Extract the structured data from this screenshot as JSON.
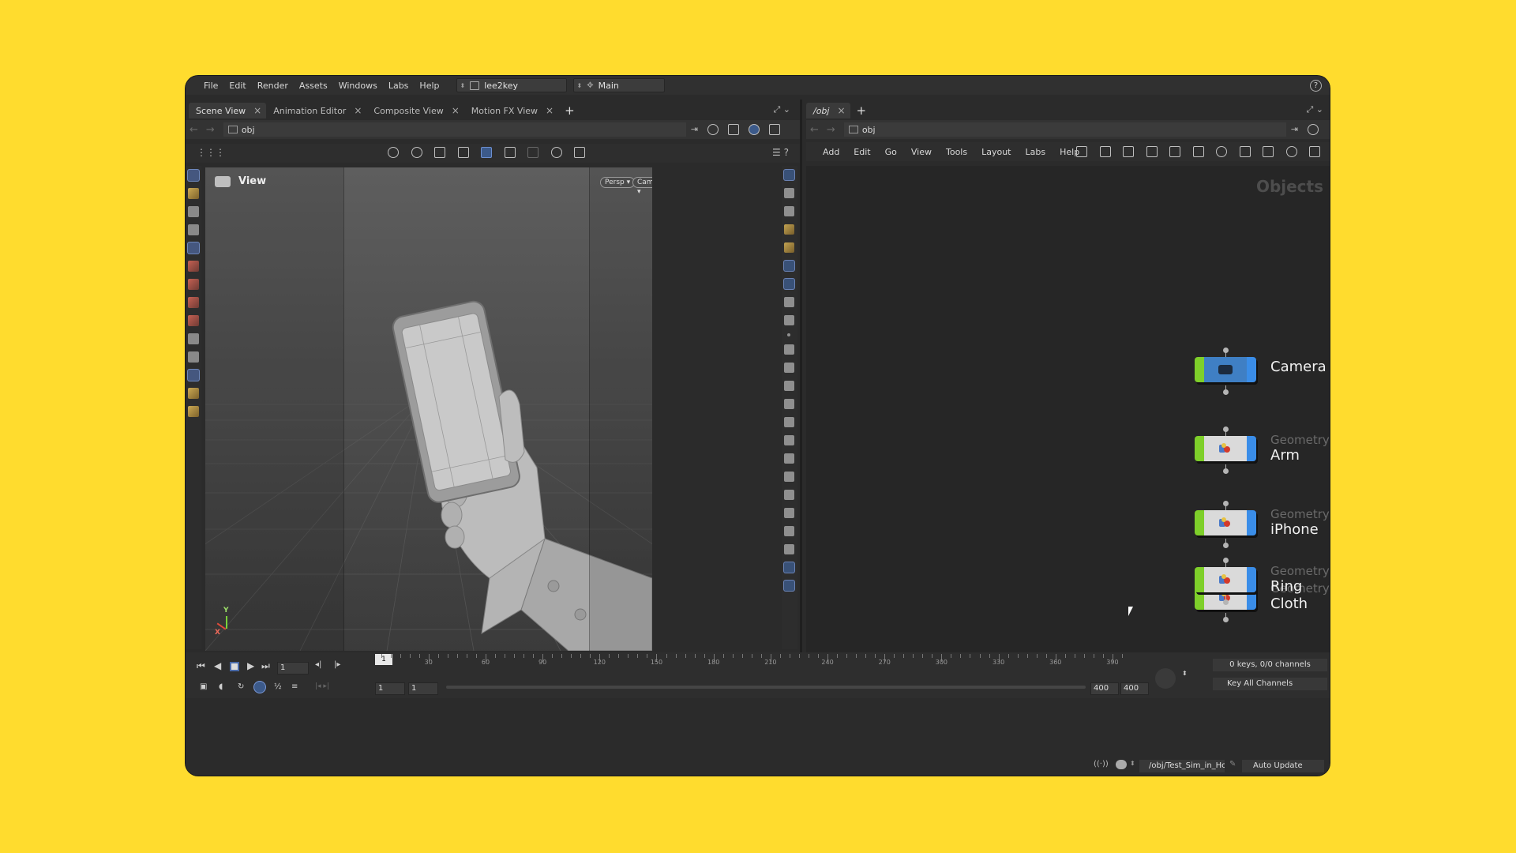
{
  "menubar": {
    "items": [
      "File",
      "Edit",
      "Render",
      "Assets",
      "Windows",
      "Labs",
      "Help"
    ],
    "desktop": "lee2key",
    "context": "Main"
  },
  "left_tabs": [
    {
      "label": "Scene View",
      "active": true
    },
    {
      "label": "Animation Editor",
      "active": false
    },
    {
      "label": "Composite View",
      "active": false
    },
    {
      "label": "Motion FX View",
      "active": false
    }
  ],
  "right_tabs": [
    {
      "label": "/obj",
      "active": true
    }
  ],
  "left_path": "obj",
  "right_path": "obj",
  "viewport": {
    "title": "View",
    "projection": "Persp",
    "camera": "Camera",
    "axis_y": "Y",
    "axis_x": "X"
  },
  "network": {
    "menu": [
      "Add",
      "Edit",
      "Go",
      "View",
      "Tools",
      "Layout",
      "Labs",
      "Help"
    ],
    "context_label": "Objects",
    "nodes": [
      {
        "type": "",
        "name": "Camera"
      },
      {
        "type": "Geometry",
        "name": "Arm"
      },
      {
        "type": "Geometry",
        "name": "iPhone"
      },
      {
        "type": "Geometry",
        "name": "Cloth"
      },
      {
        "type": "Geometry",
        "name": "Ring"
      }
    ]
  },
  "timeline": {
    "current_frame_marker": "1",
    "frame_field": "1",
    "range_start": "1",
    "range_start2": "1",
    "range_end": "400",
    "range_end2": "400",
    "ruler_labels": [
      "30",
      "60",
      "90",
      "120",
      "150",
      "180",
      "210",
      "240",
      "270",
      "300",
      "330",
      "360",
      "390"
    ],
    "keys_info": "0 keys, 0/0 channels",
    "key_all": "Key All Channels",
    "half_label": "½"
  },
  "status": {
    "path": "/obj/Test_Sim_in_Hou",
    "auto_update": "Auto Update"
  },
  "colors": {
    "background": "#FFDC2E",
    "node_green": "#7ecf2a",
    "node_blue": "#3a8de8",
    "camera_node": "#3f7fc4"
  }
}
